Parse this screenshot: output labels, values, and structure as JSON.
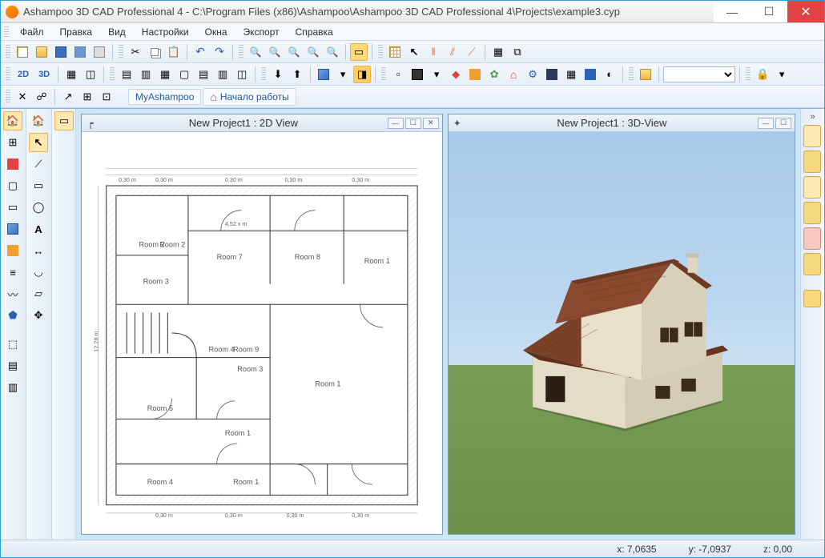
{
  "title": "Ashampoo 3D CAD Professional 4  -  C:\\Program Files (x86)\\Ashampoo\\Ashampoo 3D CAD Professional 4\\Projects\\example3.cyp",
  "menu": {
    "items": [
      "Файл",
      "Правка",
      "Вид",
      "Настройки",
      "Окна",
      "Экспорт",
      "Справка"
    ]
  },
  "links": {
    "myashampoo": "MyAshampoo",
    "start": "Начало работы"
  },
  "view2d": {
    "title": "New Project1 : 2D View"
  },
  "view3d": {
    "title": "New Project1 : 3D-View"
  },
  "rooms": {
    "r1a": "Room 1",
    "r1b": "Room 1",
    "r1c": "Room 1",
    "r1d": "Room 1",
    "r2a": "Room 2",
    "r2b": "Room 2",
    "r3a": "Room 3",
    "r3b": "Room 3",
    "r4a": "Room 4",
    "r4b": "Room 4",
    "r5": "Room 5",
    "r7": "Room 7",
    "r8": "Room 8",
    "r9": "Room 9"
  },
  "dims": {
    "top1": "0,30 m",
    "top2": "0,30 m",
    "top3": "0,30 m",
    "top4": "0,30 m",
    "top5": "0,30 m",
    "mid": "4,52 x m",
    "left": "12,28 m",
    "bot1": "0,30 m",
    "bot2": "0,30 m",
    "bot3": "0,30 m",
    "bot4": "0,30 m"
  },
  "modes": {
    "twod": "2D",
    "threed": "3D"
  },
  "status": {
    "x": "x: 7,0635",
    "y": "y: -7,0937",
    "z": "z: 0,00"
  }
}
